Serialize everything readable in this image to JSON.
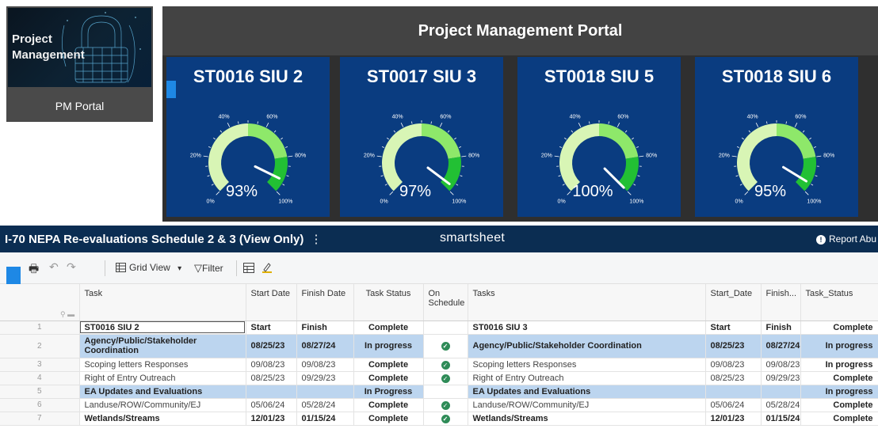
{
  "pm_tile": {
    "logo_text_line1": "Project",
    "logo_text_line2": "Management",
    "portal_label": "PM Portal"
  },
  "dashboard": {
    "title": "Project Management Portal",
    "tick_labels": [
      "0%",
      "20%",
      "40%",
      "60%",
      "80%",
      "100%"
    ],
    "gauges": [
      {
        "title": "ST0016 SIU 2",
        "value_label": "93%",
        "value": 0.93
      },
      {
        "title": "ST0017 SIU 3",
        "value_label": "97%",
        "value": 0.97
      },
      {
        "title": "ST0018 SIU 5",
        "value_label": "100%",
        "value": 1.0
      },
      {
        "title": "ST0018 SIU 6",
        "value_label": "95%",
        "value": 0.95
      }
    ],
    "colors": {
      "tile_bg": "#0a3c80",
      "gauge_light": "#d8f5b5",
      "gauge_mid": "#8ee86a",
      "gauge_dark": "#22c034"
    }
  },
  "smartsheet": {
    "sheet_title": "I-70 NEPA Re-evaluations Schedule 2 & 3 (View Only)",
    "title_menu": "⋮",
    "logo": "smartsheet",
    "report_label": "Report Abu",
    "toolbar": {
      "print_icon": "🖶",
      "undo_icon": "↶",
      "redo_icon": "↷",
      "grid_view_label": "Grid View",
      "grid_view_caret": "▾",
      "filter_label": "Filter",
      "filter_icon": "▽"
    },
    "columns": [
      "Task",
      "Start Date",
      "Finish Date",
      "Task Status",
      "On Schedule",
      "Tasks",
      "Start_Date",
      "Finish...",
      "Task_Status"
    ],
    "rows": [
      {
        "num": "1",
        "task": "ST0016 SIU 2",
        "start": "Start",
        "finish": "Finish",
        "status": "Complete",
        "check": false,
        "tasks": "ST0016 SIU 3",
        "start2": "Start",
        "finish2": "Finish",
        "status2": "Complete",
        "kind": "header"
      },
      {
        "num": "2",
        "task": "Agency/Public/Stakeholder Coordination",
        "start": "08/25/23",
        "finish": "08/27/24",
        "status": "In progress",
        "check": true,
        "tasks": "Agency/Public/Stakeholder Coordination",
        "start2": "08/25/23",
        "finish2": "08/27/24",
        "status2": "In progress",
        "kind": "group"
      },
      {
        "num": "3",
        "task": "Scoping letters Responses",
        "start": "09/08/23",
        "finish": "09/08/23",
        "status": "Complete",
        "check": true,
        "tasks": "Scoping letters Responses",
        "start2": "09/08/23",
        "finish2": "09/08/23",
        "status2": "In progress",
        "kind": "normal"
      },
      {
        "num": "4",
        "task": "Right of Entry Outreach",
        "start": "08/25/23",
        "finish": "09/29/23",
        "status": "Complete",
        "check": true,
        "tasks": "Right of Entry Outreach",
        "start2": "08/25/23",
        "finish2": "09/29/23",
        "status2": "Complete",
        "kind": "normal"
      },
      {
        "num": "5",
        "task": "EA Updates and Evaluations",
        "start": "",
        "finish": "",
        "status": "In Progress",
        "check": false,
        "tasks": "EA Updates and Evaluations",
        "start2": "",
        "finish2": "",
        "status2": "In progress",
        "kind": "group"
      },
      {
        "num": "6",
        "task": "Landuse/ROW/Community/EJ",
        "start": "05/06/24",
        "finish": "05/28/24",
        "status": "Complete",
        "check": true,
        "tasks": "Landuse/ROW/Community/EJ",
        "start2": "05/06/24",
        "finish2": "05/28/24",
        "status2": "Complete",
        "kind": "normal"
      },
      {
        "num": "7",
        "task": "Wetlands/Streams",
        "start": "12/01/23",
        "finish": "01/15/24",
        "status": "Complete",
        "check": true,
        "tasks": "Wetlands/Streams",
        "start2": "12/01/23",
        "finish2": "01/15/24",
        "status2": "Complete",
        "kind": "boldrow"
      }
    ]
  }
}
